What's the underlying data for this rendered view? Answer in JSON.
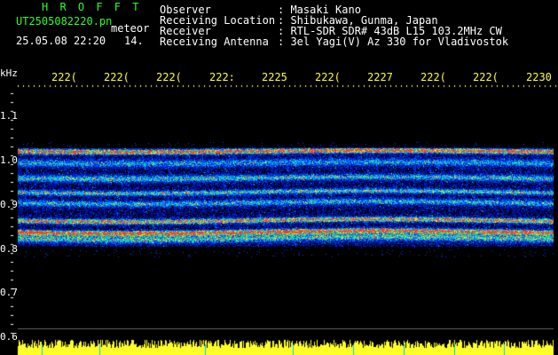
{
  "header": {
    "app_title": "H R O F F T",
    "filename": "UT2505082220.pn",
    "mode": "meteor",
    "datetime": "25.05.08 22:20",
    "counter": "14.",
    "labels": {
      "observer": "Observer",
      "location": "Receiving Location",
      "receiver": "Receiver",
      "antenna": "Receiving Antenna"
    },
    "values": {
      "observer": ": Masaki Kano",
      "location": ": Shibukawa, Gunma, Japan",
      "receiver": ": RTL-SDR SDR# 43dB L15 103.2MHz CW",
      "antenna": ": 3el Yagi(V) Az 330 for Vladivostok"
    }
  },
  "axis": {
    "unit": "kHz",
    "time_ticks": [
      "222(",
      "222(",
      "222(",
      "222:",
      "2225",
      "222(",
      "2227",
      "222(",
      "222(",
      "2230"
    ],
    "freq_labels": [
      "1.1",
      "1.0",
      "0.9",
      "0.8",
      "0.7",
      "0.6"
    ]
  },
  "colors": {
    "background": "#000000",
    "header_green": "#2bff2b",
    "tick_yellow": "#ffff3c"
  }
}
